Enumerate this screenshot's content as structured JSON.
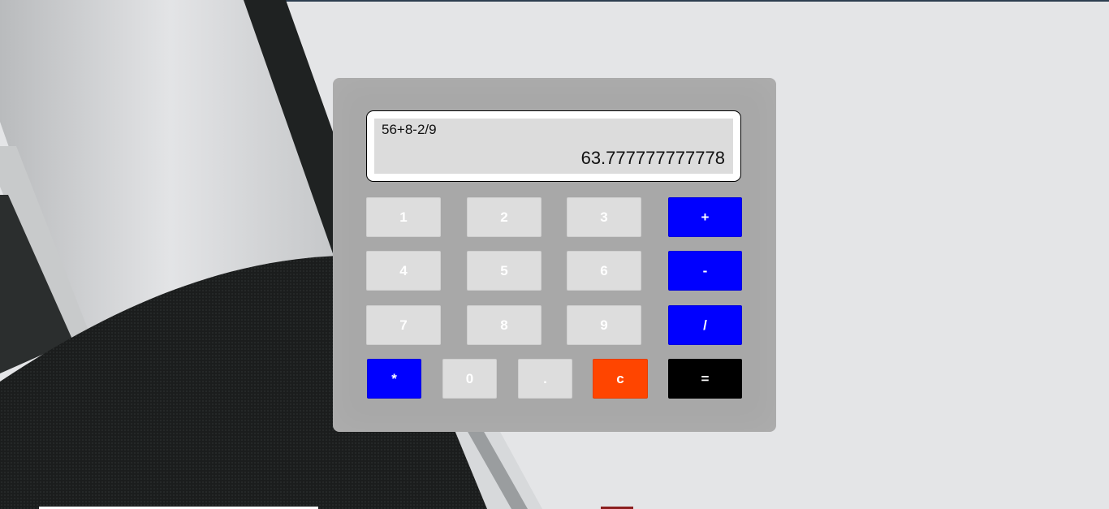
{
  "display": {
    "expression": "56+8-2/9",
    "result": "63.777777777778"
  },
  "buttons": {
    "one": "1",
    "two": "2",
    "three": "3",
    "plus": "+",
    "four": "4",
    "five": "5",
    "six": "6",
    "minus": "-",
    "seven": "7",
    "eight": "8",
    "nine": "9",
    "divide": "/",
    "multiply": "*",
    "zero": "0",
    "dot": ".",
    "clear": "c",
    "equals": "="
  },
  "colors": {
    "operator": "#0000ff",
    "clear": "#ff4500",
    "equals": "#000000",
    "number": "#dddddd",
    "body": "#a8a8a8"
  }
}
